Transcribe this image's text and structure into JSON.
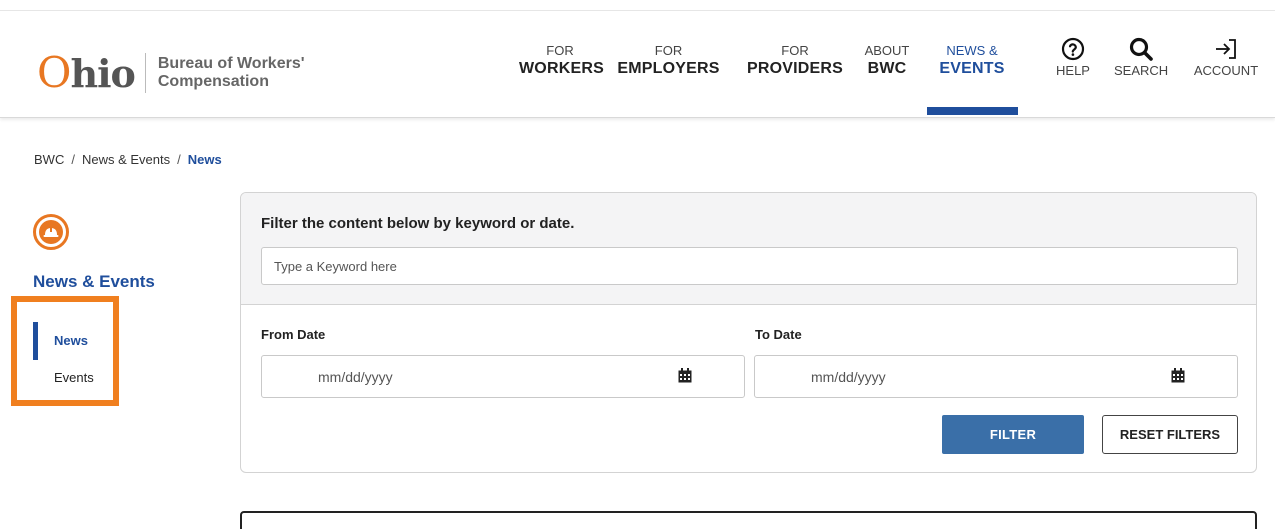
{
  "header": {
    "logo": {
      "word": "Ohio",
      "line1": "Bureau of Workers'",
      "line2": "Compensation"
    },
    "nav": [
      {
        "small": "FOR",
        "big": "WORKERS"
      },
      {
        "small": "FOR",
        "big": "EMPLOYERS"
      },
      {
        "small": "FOR",
        "big": "PROVIDERS"
      },
      {
        "small": "ABOUT",
        "big": "BWC"
      },
      {
        "small": "NEWS &",
        "big": "EVENTS",
        "active": true
      }
    ],
    "utility": [
      {
        "icon": "help-icon",
        "label": "HELP"
      },
      {
        "icon": "search-icon",
        "label": "SEARCH"
      },
      {
        "icon": "sign-in-icon",
        "label": "ACCOUNT"
      }
    ]
  },
  "breadcrumb": [
    "BWC",
    "News & Events",
    "News"
  ],
  "sidebar": {
    "icon": "hard-hat-icon",
    "title": "News & Events",
    "items": [
      {
        "label": "News",
        "active": true
      },
      {
        "label": "Events"
      }
    ]
  },
  "filter": {
    "heading": "Filter the content below by keyword or date.",
    "keyword_placeholder": "Type a Keyword here",
    "from_label": "From Date",
    "to_label": "To Date",
    "date_placeholder": "mm/dd/yyyy",
    "filter_button": "FILTER",
    "reset_button": "RESET FILTERS"
  },
  "colors": {
    "brand_blue": "#1f4e9c",
    "brand_orange": "#e87722",
    "highlight_orange": "#f07f1f",
    "button_blue": "#3a6fa8"
  }
}
